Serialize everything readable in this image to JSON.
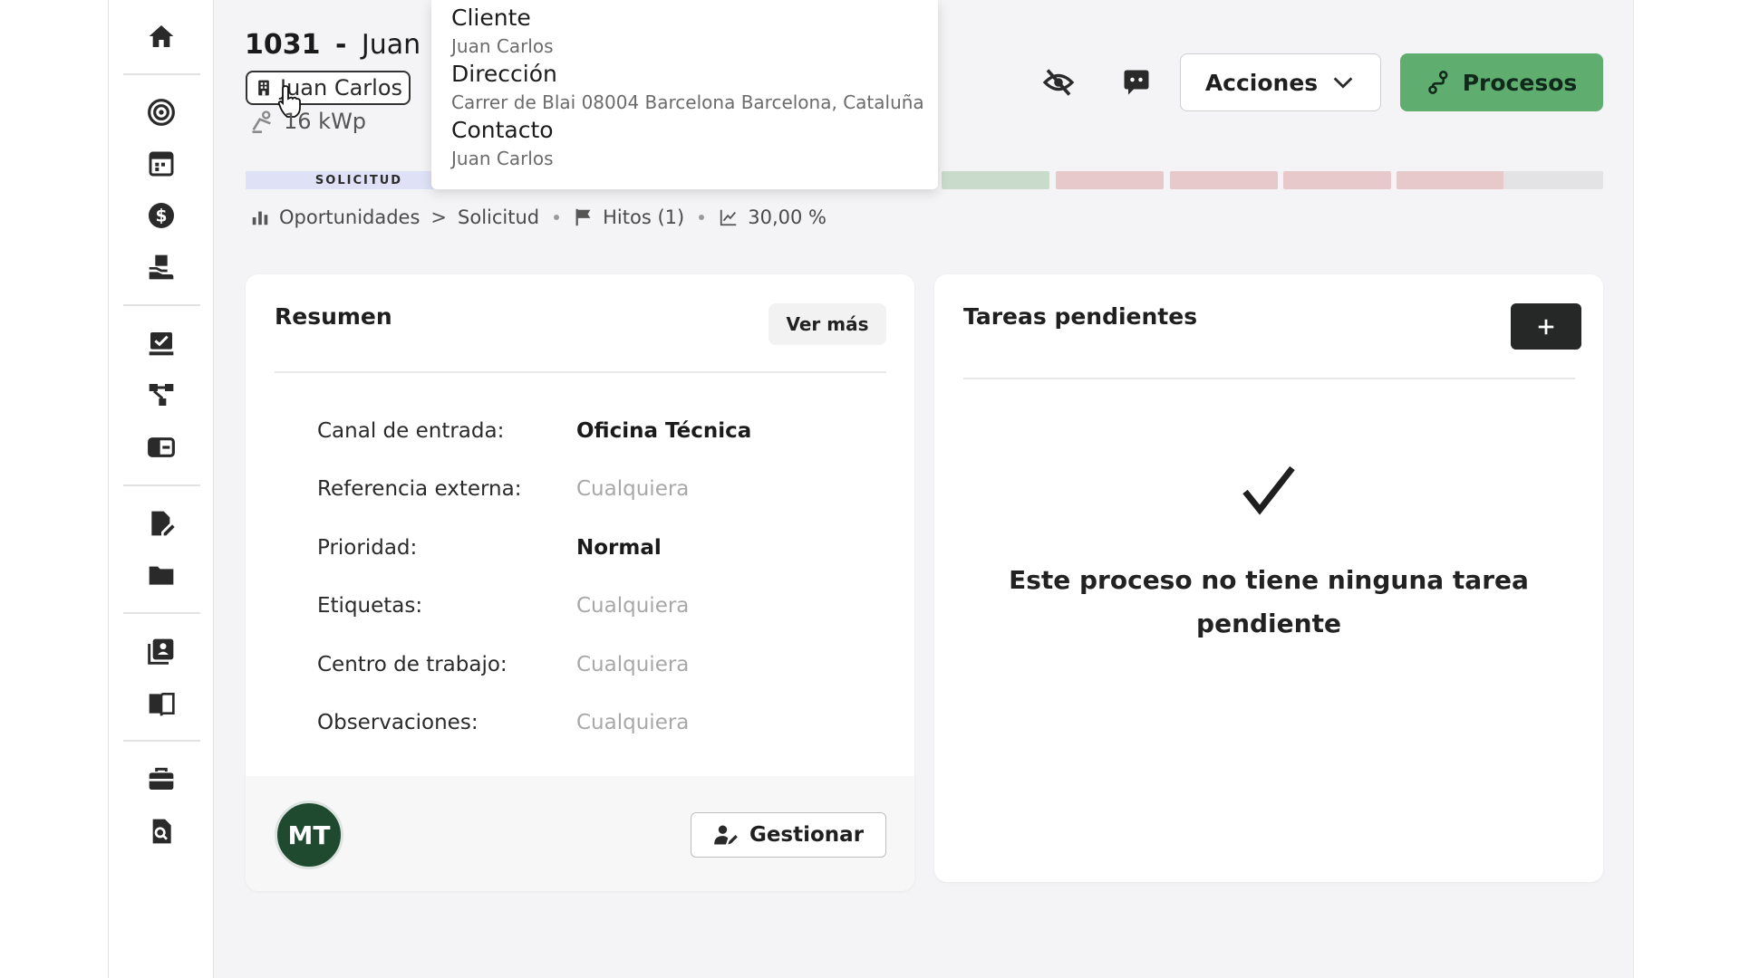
{
  "header": {
    "process_id": "1031",
    "separator": "-",
    "client_name": "Juan Carlos",
    "client_chip": "Juan Carlos",
    "power": "16 kWp"
  },
  "popover": {
    "cliente_label": "Cliente",
    "cliente_value": "Juan Carlos",
    "direccion_label": "Dirección",
    "direccion_value": "Carrer de Blai 08004 Barcelona Barcelona, Cataluña",
    "contacto_label": "Contacto",
    "contacto_value": "Juan Carlos"
  },
  "toolbar": {
    "acciones_label": "Acciones",
    "procesos_label": "Procesos"
  },
  "stages": {
    "current_label": "SOLICITUD",
    "colors": [
      "#dfe2f6",
      "#c9dccb",
      "#e7c8cb",
      "#e7c8cb",
      "#e7c8cb",
      "#e7c8cb",
      "#e3e3e5"
    ]
  },
  "breadcrumb": {
    "section": "Oportunidades",
    "chevron": ">",
    "current": "Solicitud",
    "hitos": "Hitos (1)",
    "percent": "30,00 %"
  },
  "resumen": {
    "title": "Resumen",
    "ver_mas": "Ver más",
    "fields": [
      {
        "label": "Canal de entrada:",
        "value": "Oficina Técnica"
      },
      {
        "label": "Referencia externa:",
        "value": "Cualquiera"
      },
      {
        "label": "Prioridad:",
        "value": "Normal"
      },
      {
        "label": "Etiquetas:",
        "value": "Cualquiera"
      },
      {
        "label": "Centro de trabajo:",
        "value": "Cualquiera"
      },
      {
        "label": "Observaciones:",
        "value": "Cualquiera"
      }
    ],
    "avatar_initials": "MT",
    "gestionar_label": "Gestionar"
  },
  "tareas": {
    "title": "Tareas pendientes",
    "empty_line1": "Este proceso no tiene ninguna tarea",
    "empty_line2": "pendiente"
  },
  "colors": {
    "primary_green": "#5fae70",
    "dark_button": "#252826",
    "avatar_bg": "#1f4a30",
    "placeholder_text": "#a8a8a8"
  },
  "sidebar_icons": [
    "home-icon",
    "target-icon",
    "calendar-icon",
    "dollar-icon",
    "hand-box-icon",
    "task-check-icon",
    "flow-icon",
    "ticket-icon",
    "file-sign-icon",
    "folder-icon",
    "contacts-book-icon",
    "open-book-icon",
    "toolbox-icon",
    "document-search-icon"
  ]
}
